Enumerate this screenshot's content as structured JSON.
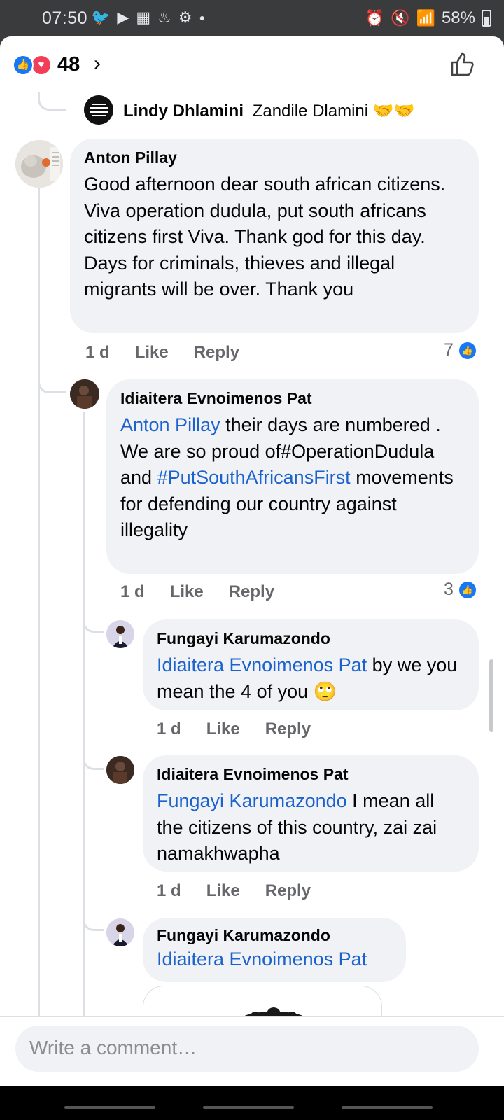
{
  "status_bar": {
    "time": "07:50",
    "battery": "58%"
  },
  "header": {
    "reaction_count": "48"
  },
  "previous_reply": {
    "author": "Lindy Dhlamini",
    "text": "Zandile Dlamini 🤝🤝"
  },
  "comments": [
    {
      "author": "Anton Pillay",
      "body": "Good afternoon dear south african citizens.  Viva operation dudula, put south africans citizens first Viva.  Thank god for this day. Days for criminals, thieves and illegal migrants will be over. Thank you",
      "time": "1 d",
      "like": "Like",
      "reply": "Reply",
      "reactions": "7"
    },
    {
      "author": "Idiaitera Evnoimenos Pat",
      "mention": "Anton Pillay",
      "body_a": " their days are numbered . We are so proud of#OperationDudula and ",
      "hashtag": "#PutSouthAfricansFirst",
      "body_b": "  movements for defending our country against illegality",
      "time": "1 d",
      "like": "Like",
      "reply": "Reply",
      "reactions": "3"
    },
    {
      "author": "Fungayi Karumazondo",
      "mention": "Idiaitera Evnoimenos Pat",
      "body": " by we you mean the 4 of you 🙄",
      "time": "1 d",
      "like": "Like",
      "reply": "Reply"
    },
    {
      "author": "Idiaitera Evnoimenos Pat",
      "mention": "Fungayi Karumazondo",
      "body": " I mean all the citizens of this country,  zai zai namakhwapha",
      "time": "1 d",
      "like": "Like",
      "reply": "Reply"
    },
    {
      "author": "Fungayi Karumazondo",
      "mention": "Idiaitera Evnoimenos Pat"
    }
  ],
  "composer": {
    "placeholder": "Write a comment…"
  },
  "colors": {
    "accent": "#1877f2",
    "link": "#1b62cc",
    "bubble": "#f0f2f5",
    "love": "#f33e58"
  },
  "icons": [
    "twitter-icon",
    "youtube-icon",
    "calendar-icon",
    "notification-icon",
    "settings-icon",
    "alarm-icon",
    "mute-icon",
    "wifi-icon",
    "signal-icon",
    "battery-icon",
    "like-reaction-icon",
    "love-reaction-icon",
    "chevron-right-icon",
    "thumbs-up-icon"
  ]
}
